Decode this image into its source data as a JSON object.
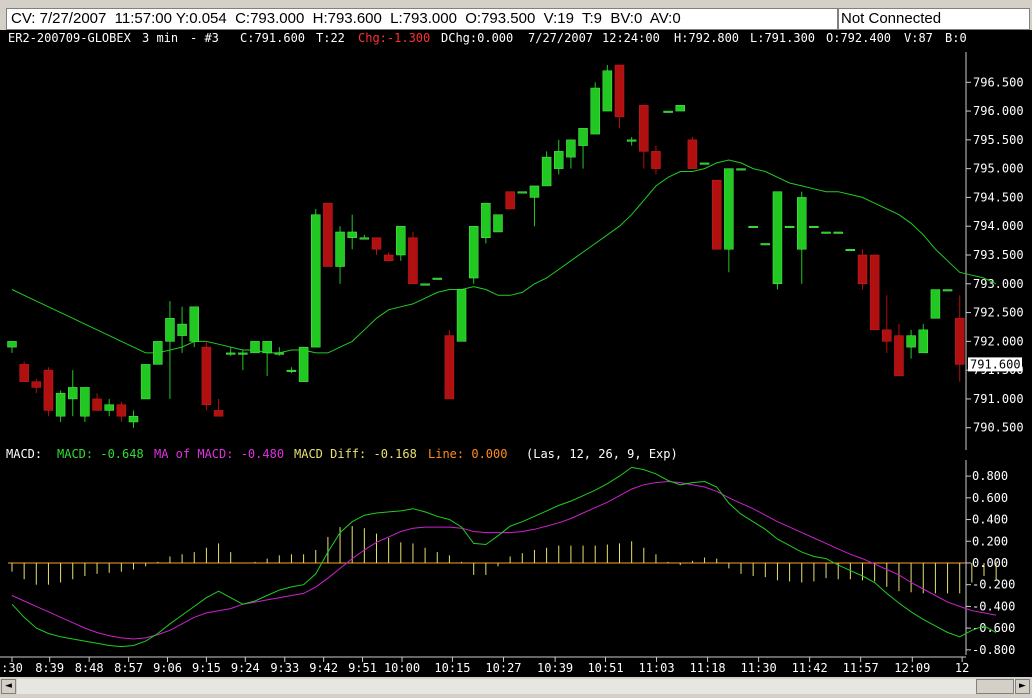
{
  "status_bar": {
    "quote": "CV: 7/27/2007  11:57:00 Y:0.054  C:793.000  H:793.600  L:793.000  O:793.500  V:19  T:9  BV:0  AV:0",
    "connection": "Not Connected"
  },
  "chart_data": [
    {
      "type": "candlestick",
      "header": {
        "symbol": "ER2-200709-GLOBEX",
        "interval": "3 min",
        "index": "- #3",
        "close": "C:791.600",
        "ticks": "T:22",
        "change": "Chg:-1.300",
        "dchange": "DChg:0.000",
        "date": "7/27/2007",
        "time": "12:24:00",
        "high": "H:792.800",
        "low": "L:791.300",
        "open": "O:792.400",
        "volume": "V:87",
        "bid": "B:0"
      },
      "last_price_label": "791.600",
      "last_price": 791.6,
      "y_range": [
        790.2,
        796.8
      ],
      "y_ticks": [
        "796.500",
        "796.000",
        "795.500",
        "795.000",
        "794.500",
        "794.000",
        "793.500",
        "793.000",
        "792.500",
        "792.000",
        "791.500",
        "791.000",
        "790.500"
      ],
      "colors": {
        "up": "#22c822",
        "down": "#b01010",
        "ma": "#22cc22",
        "grid": "#cccccc"
      },
      "ma_line": [
        792.9,
        792.8,
        792.7,
        792.6,
        792.5,
        792.4,
        792.3,
        792.2,
        792.1,
        792.0,
        791.9,
        791.8,
        791.8,
        791.85,
        791.9,
        792.0,
        792.0,
        791.95,
        791.9,
        791.85,
        791.85,
        791.8,
        791.8,
        791.85,
        791.85,
        791.8,
        791.8,
        791.9,
        792.0,
        792.2,
        792.4,
        792.55,
        792.6,
        792.65,
        792.75,
        792.85,
        792.9,
        792.9,
        792.95,
        792.9,
        792.8,
        792.8,
        792.85,
        793.0,
        793.1,
        793.25,
        793.4,
        793.55,
        793.7,
        793.85,
        794.0,
        794.2,
        794.45,
        794.7,
        794.85,
        794.95,
        794.95,
        795.0,
        795.1,
        795.15,
        795.1,
        795.0,
        794.95,
        794.85,
        794.75,
        794.7,
        794.65,
        794.6,
        794.6,
        794.55,
        794.5,
        794.4,
        794.3,
        794.2,
        794.05,
        793.85,
        793.6,
        793.4,
        793.2,
        793.15,
        793.1,
        793.0
      ],
      "candles": [
        {
          "o": 791.9,
          "h": 792.0,
          "l": 791.8,
          "c": 792.0
        },
        {
          "o": 791.6,
          "h": 791.65,
          "l": 791.3,
          "c": 791.3
        },
        {
          "o": 791.3,
          "h": 791.35,
          "l": 791.1,
          "c": 791.2
        },
        {
          "o": 791.5,
          "h": 791.55,
          "l": 790.7,
          "c": 790.8
        },
        {
          "o": 790.7,
          "h": 791.15,
          "l": 790.6,
          "c": 791.1
        },
        {
          "o": 791.0,
          "h": 791.5,
          "l": 790.7,
          "c": 791.2
        },
        {
          "o": 790.7,
          "h": 791.2,
          "l": 790.6,
          "c": 791.2
        },
        {
          "o": 791.0,
          "h": 791.1,
          "l": 790.8,
          "c": 790.8
        },
        {
          "o": 790.8,
          "h": 791.0,
          "l": 790.7,
          "c": 790.9
        },
        {
          "o": 790.9,
          "h": 790.95,
          "l": 790.6,
          "c": 790.7
        },
        {
          "o": 790.6,
          "h": 790.8,
          "l": 790.5,
          "c": 790.7
        },
        {
          "o": 791.0,
          "h": 791.6,
          "l": 791.0,
          "c": 791.6
        },
        {
          "o": 791.6,
          "h": 792.0,
          "l": 791.6,
          "c": 792.0
        },
        {
          "o": 792.0,
          "h": 792.7,
          "l": 791.0,
          "c": 792.4
        },
        {
          "o": 792.1,
          "h": 792.6,
          "l": 791.8,
          "c": 792.3
        },
        {
          "o": 792.0,
          "h": 792.6,
          "l": 791.9,
          "c": 792.6
        },
        {
          "o": 791.9,
          "h": 792.0,
          "l": 790.8,
          "c": 790.9
        },
        {
          "o": 790.8,
          "h": 791.0,
          "l": 790.7,
          "c": 790.7
        },
        {
          "o": 791.8,
          "h": 791.9,
          "l": 791.75,
          "c": 791.8
        },
        {
          "o": 791.8,
          "h": 791.85,
          "l": 791.5,
          "c": 791.8
        },
        {
          "o": 791.8,
          "h": 792.0,
          "l": 791.8,
          "c": 792.0
        },
        {
          "o": 791.8,
          "h": 792.0,
          "l": 791.4,
          "c": 792.0
        },
        {
          "o": 791.8,
          "h": 791.9,
          "l": 791.75,
          "c": 791.8
        },
        {
          "o": 791.5,
          "h": 791.55,
          "l": 791.45,
          "c": 791.5
        },
        {
          "o": 791.3,
          "h": 791.9,
          "l": 791.3,
          "c": 791.9
        },
        {
          "o": 791.9,
          "h": 794.3,
          "l": 791.9,
          "c": 794.2
        },
        {
          "o": 794.4,
          "h": 794.4,
          "l": 793.3,
          "c": 793.3
        },
        {
          "o": 793.3,
          "h": 794.0,
          "l": 793.0,
          "c": 793.9
        },
        {
          "o": 793.8,
          "h": 794.2,
          "l": 793.6,
          "c": 793.9
        },
        {
          "o": 793.8,
          "h": 793.85,
          "l": 793.8,
          "c": 793.8
        },
        {
          "o": 793.8,
          "h": 793.8,
          "l": 793.5,
          "c": 793.6
        },
        {
          "o": 793.5,
          "h": 793.55,
          "l": 793.4,
          "c": 793.4
        },
        {
          "o": 793.5,
          "h": 794.0,
          "l": 793.4,
          "c": 794.0
        },
        {
          "o": 793.8,
          "h": 793.9,
          "l": 793.0,
          "c": 793.0
        },
        {
          "o": 793.0,
          "h": 793.0,
          "l": 793.0,
          "c": 793.0
        },
        {
          "o": 793.1,
          "h": 793.1,
          "l": 793.1,
          "c": 793.1
        },
        {
          "o": 792.1,
          "h": 792.2,
          "l": 791.0,
          "c": 791.0
        },
        {
          "o": 792.0,
          "h": 792.9,
          "l": 792.0,
          "c": 792.9
        },
        {
          "o": 793.1,
          "h": 794.0,
          "l": 793.0,
          "c": 794.0
        },
        {
          "o": 793.8,
          "h": 794.4,
          "l": 793.7,
          "c": 794.4
        },
        {
          "o": 793.9,
          "h": 794.2,
          "l": 793.9,
          "c": 794.2
        },
        {
          "o": 794.6,
          "h": 794.6,
          "l": 794.3,
          "c": 794.3
        },
        {
          "o": 794.6,
          "h": 794.6,
          "l": 794.6,
          "c": 794.6
        },
        {
          "o": 794.5,
          "h": 794.7,
          "l": 794.0,
          "c": 794.7
        },
        {
          "o": 794.7,
          "h": 795.3,
          "l": 794.7,
          "c": 795.2
        },
        {
          "o": 795.0,
          "h": 795.5,
          "l": 794.9,
          "c": 795.3
        },
        {
          "o": 795.2,
          "h": 795.5,
          "l": 795.0,
          "c": 795.5
        },
        {
          "o": 795.4,
          "h": 795.7,
          "l": 795.0,
          "c": 795.7
        },
        {
          "o": 795.6,
          "h": 796.5,
          "l": 795.6,
          "c": 796.4
        },
        {
          "o": 796.0,
          "h": 796.8,
          "l": 796.0,
          "c": 796.7
        },
        {
          "o": 796.8,
          "h": 796.8,
          "l": 795.7,
          "c": 795.9
        },
        {
          "o": 795.5,
          "h": 795.55,
          "l": 795.4,
          "c": 795.5
        },
        {
          "o": 796.1,
          "h": 796.1,
          "l": 795.0,
          "c": 795.3
        },
        {
          "o": 795.3,
          "h": 795.4,
          "l": 794.9,
          "c": 795.0
        },
        {
          "o": 796.0,
          "h": 796.0,
          "l": 796.0,
          "c": 796.0
        },
        {
          "o": 796.0,
          "h": 796.1,
          "l": 796.0,
          "c": 796.1
        },
        {
          "o": 795.5,
          "h": 795.55,
          "l": 795.0,
          "c": 795.0
        },
        {
          "o": 795.1,
          "h": 795.1,
          "l": 795.1,
          "c": 795.1
        },
        {
          "o": 794.8,
          "h": 794.8,
          "l": 793.6,
          "c": 793.6
        },
        {
          "o": 793.6,
          "h": 795.0,
          "l": 793.2,
          "c": 795.0
        },
        {
          "o": 795.0,
          "h": 795.0,
          "l": 795.0,
          "c": 795.0
        },
        {
          "o": 794.0,
          "h": 794.0,
          "l": 794.0,
          "c": 794.0
        },
        {
          "o": 793.7,
          "h": 793.7,
          "l": 793.7,
          "c": 793.7
        },
        {
          "o": 793.0,
          "h": 794.6,
          "l": 792.9,
          "c": 794.6
        },
        {
          "o": 794.0,
          "h": 794.0,
          "l": 794.0,
          "c": 794.0
        },
        {
          "o": 793.6,
          "h": 794.6,
          "l": 793.0,
          "c": 794.5
        },
        {
          "o": 794.0,
          "h": 794.0,
          "l": 794.0,
          "c": 794.0
        },
        {
          "o": 793.9,
          "h": 793.9,
          "l": 793.9,
          "c": 793.9
        },
        {
          "o": 793.9,
          "h": 793.9,
          "l": 793.9,
          "c": 793.9
        },
        {
          "o": 793.6,
          "h": 793.6,
          "l": 793.6,
          "c": 793.6
        },
        {
          "o": 793.5,
          "h": 793.6,
          "l": 792.9,
          "c": 793.0
        },
        {
          "o": 793.5,
          "h": 793.5,
          "l": 792.2,
          "c": 792.2
        },
        {
          "o": 792.2,
          "h": 792.8,
          "l": 791.8,
          "c": 792.0
        },
        {
          "o": 792.1,
          "h": 792.3,
          "l": 791.4,
          "c": 791.4
        },
        {
          "o": 791.9,
          "h": 792.2,
          "l": 791.7,
          "c": 792.1
        },
        {
          "o": 791.8,
          "h": 792.3,
          "l": 791.8,
          "c": 792.2
        },
        {
          "o": 792.4,
          "h": 792.9,
          "l": 792.4,
          "c": 792.9
        },
        {
          "o": 792.9,
          "h": 792.9,
          "l": 792.9,
          "c": 792.9
        },
        {
          "o": 792.4,
          "h": 792.8,
          "l": 791.3,
          "c": 791.6
        }
      ]
    },
    {
      "type": "macd",
      "header": {
        "title": "MACD:",
        "macd": "MACD: -0.648",
        "ma_of_macd": "MA of MACD: -0.480",
        "diff": "MACD Diff: -0.168",
        "line": "Line: 0.000",
        "params": "(Las, 12, 26, 9, Exp)"
      },
      "y_range": [
        -0.82,
        0.93
      ],
      "y_ticks": [
        "0.800",
        "0.600",
        "0.400",
        "0.200",
        "0.000",
        "-0.200",
        "-0.400",
        "-0.600",
        "-0.800"
      ],
      "colors": {
        "macd": "#22cc22",
        "ma": "#cc22cc",
        "hist": "#e8e070",
        "zero": "#ffa020",
        "header_macd": "#33dd33",
        "header_ma": "#dd33dd",
        "header_diff": "#e8e070",
        "header_line": "#ff8a20"
      },
      "macd": [
        -0.38,
        -0.5,
        -0.6,
        -0.65,
        -0.68,
        -0.7,
        -0.72,
        -0.74,
        -0.76,
        -0.77,
        -0.76,
        -0.72,
        -0.65,
        -0.56,
        -0.48,
        -0.4,
        -0.32,
        -0.26,
        -0.32,
        -0.38,
        -0.35,
        -0.3,
        -0.25,
        -0.22,
        -0.2,
        -0.1,
        0.1,
        0.28,
        0.38,
        0.44,
        0.46,
        0.47,
        0.48,
        0.5,
        0.47,
        0.43,
        0.4,
        0.33,
        0.18,
        0.17,
        0.25,
        0.34,
        0.38,
        0.43,
        0.48,
        0.53,
        0.57,
        0.62,
        0.67,
        0.73,
        0.8,
        0.88,
        0.86,
        0.82,
        0.76,
        0.72,
        0.74,
        0.75,
        0.7,
        0.55,
        0.45,
        0.38,
        0.31,
        0.22,
        0.16,
        0.1,
        0.06,
        0.04,
        -0.02,
        -0.07,
        -0.12,
        -0.18,
        -0.28,
        -0.37,
        -0.45,
        -0.52,
        -0.58,
        -0.64,
        -0.68,
        -0.62,
        -0.58,
        -0.64
      ],
      "ma_of_macd": [
        -0.3,
        -0.35,
        -0.4,
        -0.45,
        -0.5,
        -0.55,
        -0.6,
        -0.64,
        -0.67,
        -0.69,
        -0.7,
        -0.69,
        -0.66,
        -0.62,
        -0.56,
        -0.5,
        -0.46,
        -0.44,
        -0.42,
        -0.38,
        -0.36,
        -0.34,
        -0.32,
        -0.3,
        -0.28,
        -0.22,
        -0.14,
        -0.05,
        0.04,
        0.12,
        0.19,
        0.24,
        0.29,
        0.32,
        0.33,
        0.33,
        0.33,
        0.32,
        0.29,
        0.28,
        0.28,
        0.28,
        0.29,
        0.31,
        0.34,
        0.37,
        0.41,
        0.46,
        0.51,
        0.56,
        0.62,
        0.68,
        0.72,
        0.74,
        0.75,
        0.74,
        0.72,
        0.7,
        0.66,
        0.6,
        0.55,
        0.5,
        0.44,
        0.38,
        0.33,
        0.28,
        0.23,
        0.18,
        0.13,
        0.08,
        0.04,
        -0.01,
        -0.06,
        -0.11,
        -0.18,
        -0.24,
        -0.3,
        -0.36,
        -0.4,
        -0.44,
        -0.46,
        -0.48
      ]
    }
  ],
  "x_axis": {
    "labels": [
      ":30",
      "8:39",
      "8:48",
      "8:57",
      "9:06",
      "9:15",
      "9:24",
      "9:33",
      "9:42",
      "9:51",
      "10:00",
      "10:15",
      "10:27",
      "10:39",
      "10:51",
      "11:03",
      "11:18",
      "11:30",
      "11:42",
      "11:57",
      "12:09",
      "12"
    ],
    "label_index": [
      0,
      3.1,
      6.35,
      9.6,
      12.8,
      16,
      19.2,
      22.45,
      25.65,
      28.85,
      32.1,
      36.25,
      40.45,
      44.7,
      48.85,
      53.05,
      57.25,
      61.45,
      65.65,
      69.85,
      74.1,
      78.2
    ]
  },
  "scrollbar": {
    "left_arrow": "◄",
    "right_arrow": "►"
  }
}
